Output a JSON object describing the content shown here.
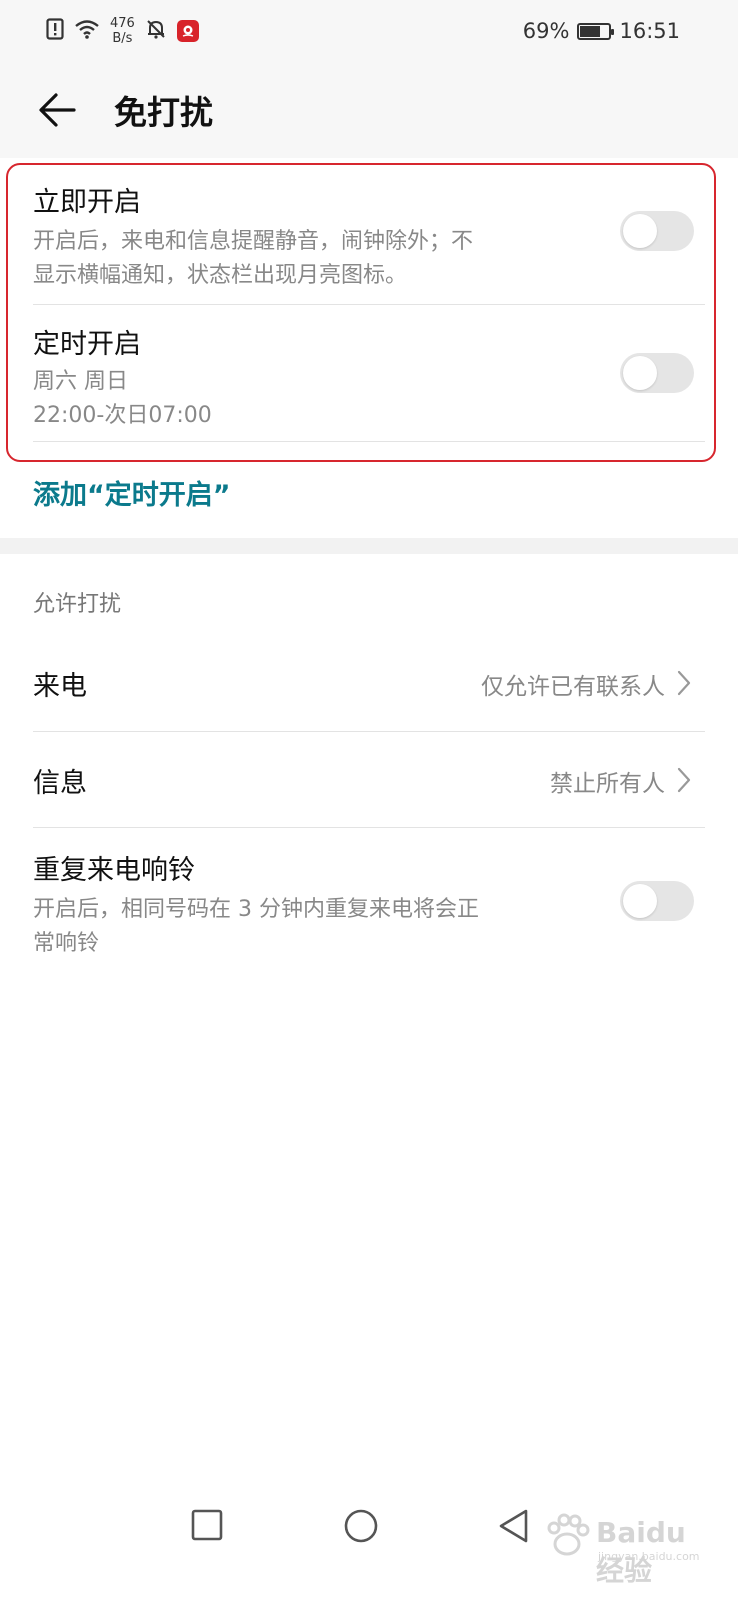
{
  "status_bar": {
    "net_speed_value": "476",
    "net_speed_unit": "B/s",
    "battery_percent": "69%",
    "battery_level": 0.69,
    "time": "16:51",
    "icons": [
      "sim-alert-icon",
      "wifi-icon",
      "bell-off-icon",
      "app-notification-icon",
      "battery-icon"
    ]
  },
  "header": {
    "title": "免打扰",
    "back_icon": "back-arrow-icon"
  },
  "schedule": {
    "immediate": {
      "title": "立即开启",
      "description": "开启后，来电和信息提醒静音，闹钟除外；不显示横幅通知，状态栏出现月亮图标。",
      "description_line1": "开启后，来电和信息提醒静音，闹钟除外；不",
      "description_line2": "显示横幅通知，状态栏出现月亮图标。",
      "enabled": false
    },
    "timed": {
      "title": "定时开启",
      "days": "周六 周日",
      "time_range": "22:00-次日07:00",
      "enabled": false
    },
    "add_link": "添加“定时开启”"
  },
  "allow": {
    "section_title": "允许打扰",
    "calls": {
      "label": "来电",
      "value": "仅允许已有联系人"
    },
    "messages": {
      "label": "信息",
      "value": "禁止所有人"
    },
    "repeat_calls": {
      "title": "重复来电响铃",
      "description_line1": "开启后，相同号码在 3 分钟内重复来电将会正",
      "description_line2": "常响铃",
      "enabled": false
    }
  },
  "navigation": {
    "buttons": [
      "recents-square-icon",
      "home-circle-icon",
      "back-triangle-icon"
    ]
  },
  "watermark": {
    "text": "Baidu经验",
    "url": "jingyan.baidu.com"
  },
  "colors": {
    "accent_link": "#0b7a8c",
    "highlight_border": "#d7262e",
    "toggle_off": "#e5e5e5"
  }
}
